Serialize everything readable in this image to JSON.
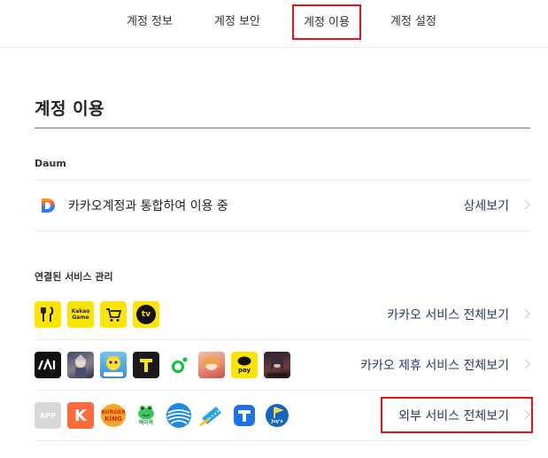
{
  "tabs": [
    {
      "label": "계정 정보"
    },
    {
      "label": "계정 보안"
    },
    {
      "label": "계정 이용"
    },
    {
      "label": "계정 설정"
    }
  ],
  "page": {
    "title": "계정 이용"
  },
  "daum": {
    "section_label": "Daum",
    "status_text": "카카오계정과 통합하여 이용 중",
    "detail_link": "상세보기",
    "icon": "daum-icon"
  },
  "connected": {
    "section_label": "연결된 서비스 관리",
    "rows": [
      {
        "link": "카카오 서비스 전체보기",
        "icons": [
          "kakao-food-icon",
          "kakao-game-icon",
          "kakao-shopping-icon",
          "kakao-tv-icon"
        ],
        "icon_text": {
          "game": "Kakao\nGame",
          "tv": "tv"
        }
      },
      {
        "link": "카카오 제휴 서비스 전체보기",
        "icons": [
          "kakao-ni-icon",
          "game-character-icon",
          "mobile-game-icon",
          "kakao-t-icon",
          "kakao-green-dot-icon",
          "anime-game-icon",
          "kakao-pay-icon",
          "dark-game-icon"
        ],
        "icon_text": {
          "pay": "pay"
        }
      },
      {
        "link": "외부 서비스 전체보기",
        "icons": [
          "app-icon",
          "k-icon",
          "burger-king-icon",
          "frog-app-icon",
          "globe-app-icon",
          "ticket-app-icon",
          "t-app-icon",
          "golf-app-icon"
        ],
        "icon_text": {
          "app": "APP",
          "k": "K",
          "bk_top": "BURGER",
          "bk_bottom": "KING",
          "frog": "팩이톡",
          "golf": "Joy's"
        }
      }
    ]
  },
  "colors": {
    "accent_red": "#e8141b",
    "kakao_yellow": "#fee500",
    "link_navy": "#2b3a67"
  }
}
